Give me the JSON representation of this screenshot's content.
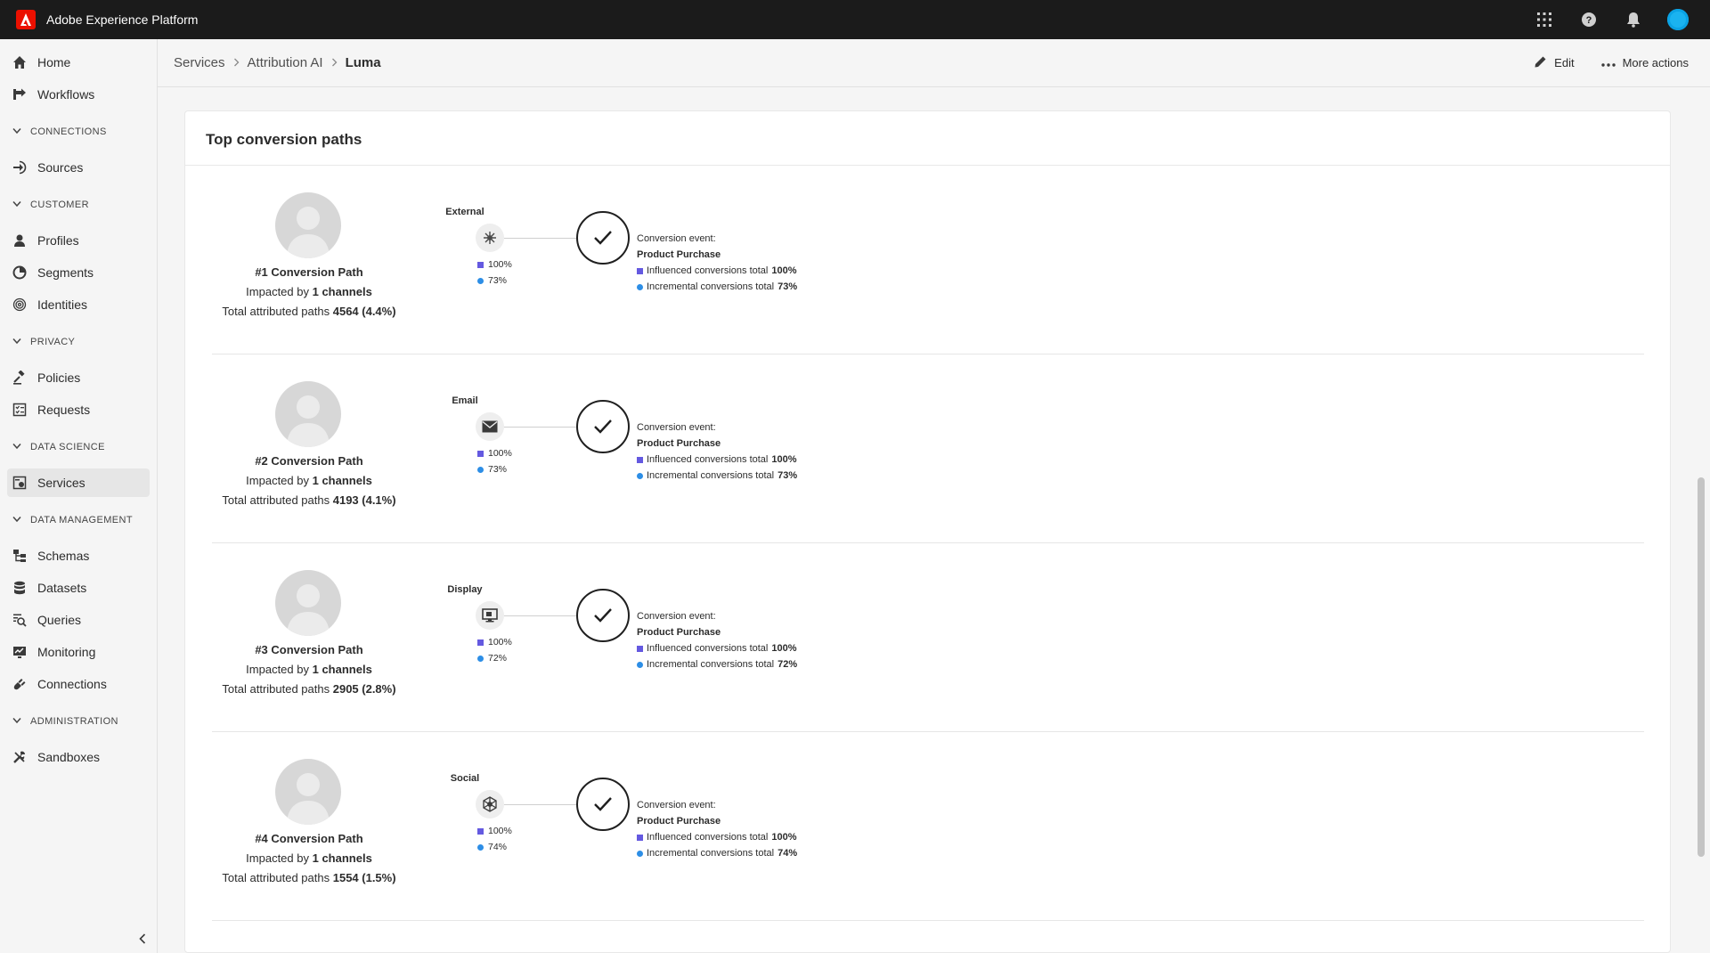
{
  "app": {
    "title": "Adobe Experience Platform"
  },
  "topbar": {
    "icons": [
      "apps-grid-icon",
      "help-icon",
      "notifications-bell-icon",
      "user-avatar"
    ]
  },
  "sidebar": {
    "home": "Home",
    "workflows": "Workflows",
    "connections_section": "CONNECTIONS",
    "sources": "Sources",
    "customer_section": "CUSTOMER",
    "profiles": "Profiles",
    "segments": "Segments",
    "identities": "Identities",
    "privacy_section": "PRIVACY",
    "policies": "Policies",
    "requests": "Requests",
    "data_science_section": "DATA SCIENCE",
    "services": "Services",
    "data_management_section": "DATA MANAGEMENT",
    "schemas": "Schemas",
    "datasets": "Datasets",
    "queries": "Queries",
    "monitoring": "Monitoring",
    "connections": "Connections",
    "administration_section": "ADMINISTRATION",
    "sandboxes": "Sandboxes"
  },
  "header": {
    "breadcrumb": [
      "Services",
      "Attribution AI",
      "Luma"
    ],
    "edit_label": "Edit",
    "more_actions_label": "More actions"
  },
  "card": {
    "title": "Top conversion paths"
  },
  "paths": [
    {
      "title": "#1 Conversion Path",
      "impacted_prefix": "Impacted by ",
      "impacted_value": "1 channels",
      "total_prefix": "Total attributed paths ",
      "total_value": "4564 (4.4%)",
      "channel": "External",
      "channel_icon": "external-network-icon",
      "influenced_pct": "100%",
      "incremental_pct": "73%",
      "conversion_label": "Conversion event:",
      "conversion_event": "Product Purchase",
      "influenced_text": "Influenced conversions total ",
      "influenced_total": "100%",
      "incremental_text": "Incremental conversions total ",
      "incremental_total": "73%"
    },
    {
      "title": "#2 Conversion Path",
      "impacted_prefix": "Impacted by ",
      "impacted_value": "1 channels",
      "total_prefix": "Total attributed paths ",
      "total_value": "4193 (4.1%)",
      "channel": "Email",
      "channel_icon": "email-envelope-icon",
      "influenced_pct": "100%",
      "incremental_pct": "73%",
      "conversion_label": "Conversion event:",
      "conversion_event": "Product Purchase",
      "influenced_text": "Influenced conversions total ",
      "influenced_total": "100%",
      "incremental_text": "Incremental conversions total ",
      "incremental_total": "73%"
    },
    {
      "title": "#3 Conversion Path",
      "impacted_prefix": "Impacted by ",
      "impacted_value": "1 channels",
      "total_prefix": "Total attributed paths ",
      "total_value": "2905 (2.8%)",
      "channel": "Display",
      "channel_icon": "display-monitor-icon",
      "influenced_pct": "100%",
      "incremental_pct": "72%",
      "conversion_label": "Conversion event:",
      "conversion_event": "Product Purchase",
      "influenced_text": "Influenced conversions total ",
      "influenced_total": "100%",
      "incremental_text": "Incremental conversions total ",
      "incremental_total": "72%"
    },
    {
      "title": "#4 Conversion Path",
      "impacted_prefix": "Impacted by ",
      "impacted_value": "1 channels",
      "total_prefix": "Total attributed paths ",
      "total_value": "1554 (1.5%)",
      "channel": "Social",
      "channel_icon": "social-network-icon",
      "influenced_pct": "100%",
      "incremental_pct": "74%",
      "conversion_label": "Conversion event:",
      "conversion_event": "Product Purchase",
      "influenced_text": "Influenced conversions total ",
      "influenced_total": "100%",
      "incremental_text": "Incremental conversions total ",
      "incremental_total": "74%"
    }
  ],
  "colors": {
    "topbar": "#1b1b1b",
    "influenced": "#6459e0",
    "incremental": "#2d8ee6",
    "avatar": "#1ab3f0",
    "adobe_red": "#eb1000"
  }
}
